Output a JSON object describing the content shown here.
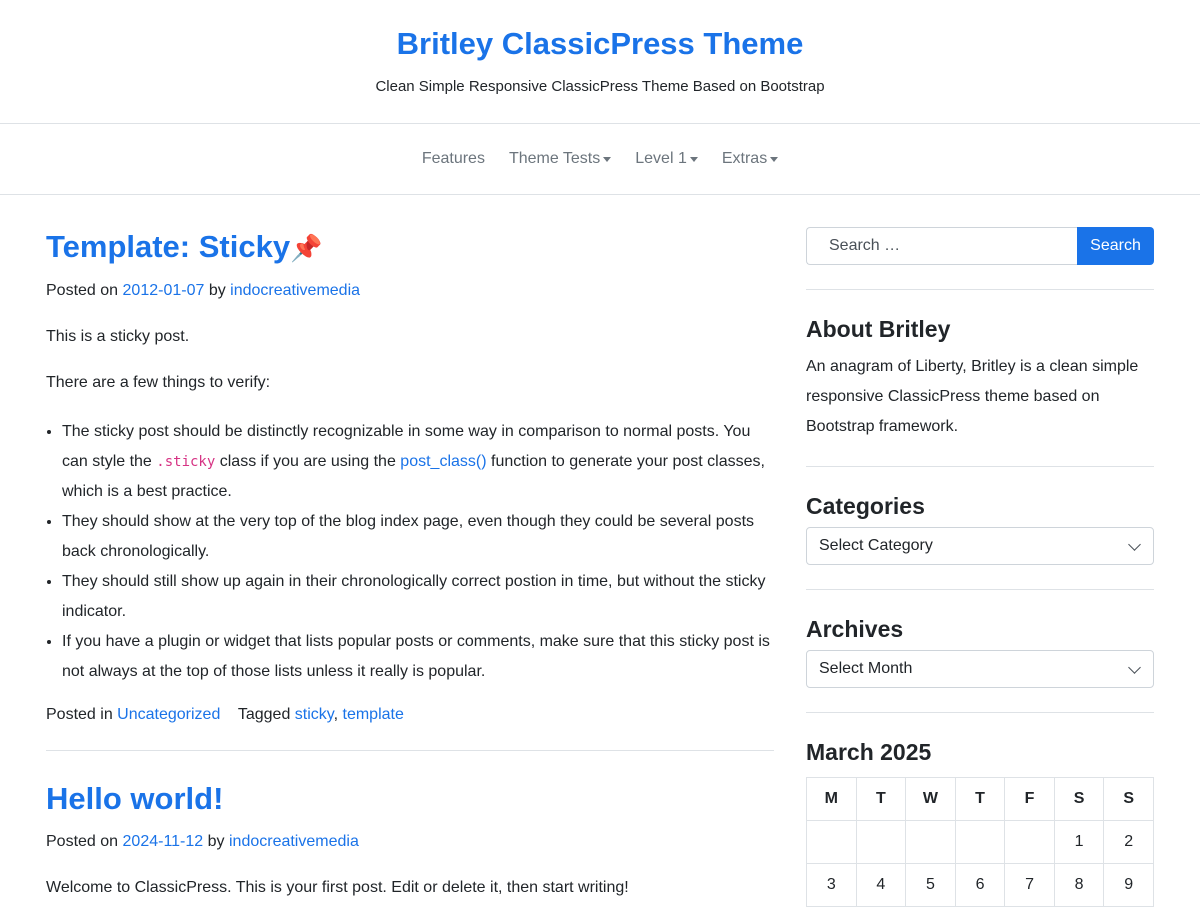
{
  "site": {
    "title": "Britley ClassicPress Theme",
    "description": "Clean Simple Responsive ClassicPress Theme Based on Bootstrap"
  },
  "nav": {
    "items": [
      {
        "label": "Features"
      },
      {
        "label": "Theme Tests"
      },
      {
        "label": "Level 1"
      },
      {
        "label": "Extras"
      }
    ]
  },
  "posts": [
    {
      "title": "Template: Sticky",
      "pin_glyph": "📌",
      "posted_on_label": "Posted on",
      "date": "2012-01-07",
      "by_label": "by",
      "author": "indocreativemedia",
      "paragraphs": [
        "This is a sticky post.",
        "There are a few things to verify:"
      ],
      "list": {
        "item1_pre": "The sticky post should be distinctly recognizable in some way in comparison to normal posts. You can style the",
        "item1_code": ".sticky",
        "item1_mid": "class if you are using the",
        "item1_link": "post_class()",
        "item1_post": "function to generate your post classes, which is a best practice.",
        "item2": "They should show at the very top of the blog index page, even though they could be several posts back chronologically.",
        "item3": "They should still show up again in their chronologically correct postion in time, but without the sticky indicator.",
        "item4": "If you have a plugin or widget that lists popular posts or comments, make sure that this sticky post is not always at the top of those lists unless it really is popular."
      },
      "posted_in_label": "Posted in",
      "category": "Uncategorized",
      "tagged_label": "Tagged",
      "tags": [
        "sticky",
        "template"
      ]
    },
    {
      "title": "Hello world!",
      "posted_on_label": "Posted on",
      "date": "2024-11-12",
      "by_label": "by",
      "author": "indocreativemedia",
      "excerpt": "Welcome to ClassicPress. This is your first post. Edit or delete it, then start writing!"
    }
  ],
  "sidebar": {
    "search": {
      "placeholder": "Search …",
      "button": "Search"
    },
    "about": {
      "title": "About Britley",
      "text": "An anagram of Liberty, Britley is a clean simple responsive ClassicPress theme based on Bootstrap framework."
    },
    "categories": {
      "title": "Categories",
      "selected": "Select Category"
    },
    "archives": {
      "title": "Archives",
      "selected": "Select Month"
    },
    "calendar": {
      "title": "March 2025",
      "days": [
        "M",
        "T",
        "W",
        "T",
        "F",
        "S",
        "S"
      ],
      "rows": [
        [
          "",
          "",
          "",
          "",
          "",
          "1",
          "2"
        ],
        [
          "3",
          "4",
          "5",
          "6",
          "7",
          "8",
          "9"
        ]
      ]
    }
  },
  "colors": {
    "accent": "#1a73e8",
    "text": "#212529",
    "muted": "#6c757d",
    "border": "#dee2e6"
  }
}
